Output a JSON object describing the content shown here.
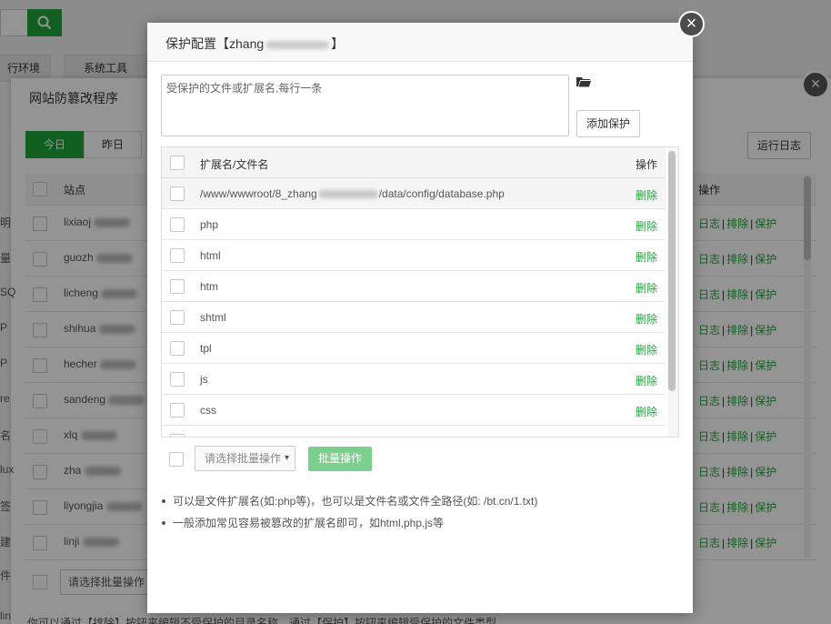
{
  "background": {
    "search_icon": "search-icon",
    "top_tabs": [
      "行环境",
      "系统工具"
    ],
    "panel_title": "网站防篡改程序",
    "day_tabs": [
      "今日",
      "昨日"
    ],
    "run_log_button": "运行日志",
    "table_head": {
      "site": "站点",
      "ops": "操作"
    },
    "rows": [
      {
        "site": "lixiaoj"
      },
      {
        "site": "guozh"
      },
      {
        "site": "licheng"
      },
      {
        "site": "shihua"
      },
      {
        "site": "hecher"
      },
      {
        "site": "sandeng"
      },
      {
        "site": "xlq"
      },
      {
        "site": "zha"
      },
      {
        "site": "liyongjia"
      },
      {
        "site": "linji"
      }
    ],
    "row_ops": {
      "log": "日志",
      "exclude": "排除",
      "protect": "保护",
      "sep": "|"
    },
    "batch_select_placeholder": "请选择批量操作",
    "bottom_tip": "你可以通过【排除】按钮来编辑不受保护的目录名称，通过【保护】按钮来编辑受保护的文件类型",
    "left_cut_labels": [
      "明",
      "量",
      "SQ",
      "P",
      "P",
      "re",
      "名",
      "lux",
      "签",
      "建",
      "件",
      "lin"
    ]
  },
  "dialog": {
    "title": "保护配置【zhang",
    "title_suffix": "】",
    "close_icon": "close-icon",
    "input_placeholder": "受保护的文件或扩展名,每行一条",
    "folder_icon": "folder-open-icon",
    "add_button": "添加保护",
    "list_head": {
      "name": "扩展名/文件名",
      "op": "操作"
    },
    "items": [
      {
        "name": "/www/wwwroot/8_zhang",
        "name_tail": "/data/config/database.php",
        "op": "删除"
      },
      {
        "name": "php",
        "op": "删除"
      },
      {
        "name": "html",
        "op": "删除"
      },
      {
        "name": "htm",
        "op": "删除"
      },
      {
        "name": "shtml",
        "op": "删除"
      },
      {
        "name": "tpl",
        "op": "删除"
      },
      {
        "name": "js",
        "op": "删除"
      },
      {
        "name": "css",
        "op": "删除"
      },
      {
        "name": "",
        "op": "删除"
      }
    ],
    "batch_select_placeholder": "请选择批量操作",
    "batch_button": "批量操作",
    "tips": [
      "可以是文件扩展名(如:php等)，也可以是文件名或文件全路径(如: /bt.cn/1.txt)",
      "一般添加常见容易被篡改的扩展名即可，如html,php,js等"
    ]
  },
  "colors": {
    "accent": "#20a53a",
    "accent_light": "#7dcf8e",
    "overlay": "rgba(0,0,0,0.42)"
  }
}
